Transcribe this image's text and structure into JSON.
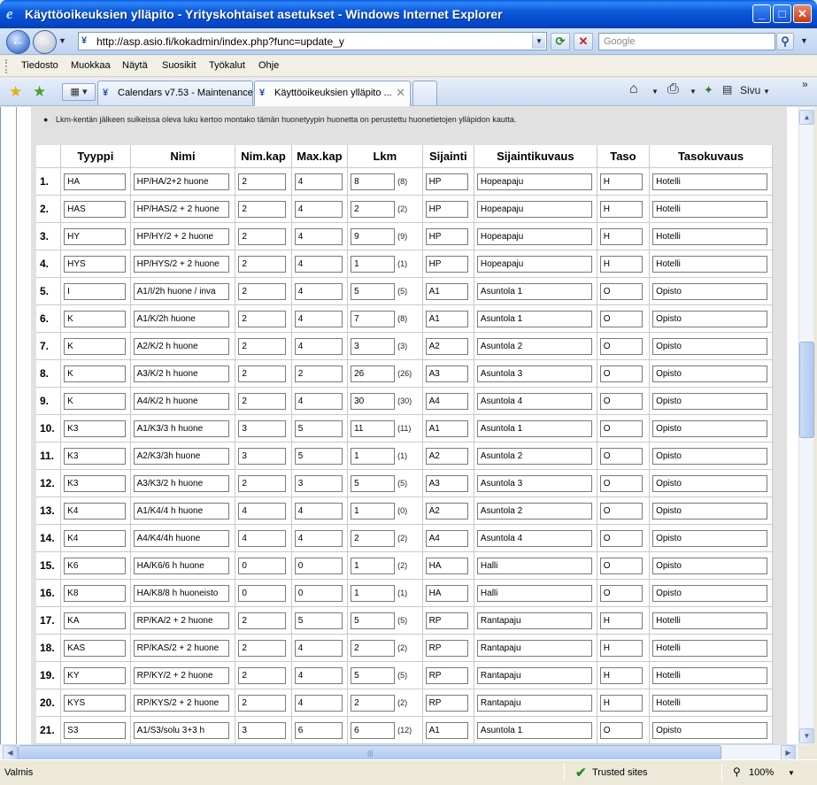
{
  "window": {
    "title": "Käyttöoikeuksien ylläpito - Yrityskohtaiset asetukset - Windows Internet Explorer",
    "buttons": {
      "minimize": "_",
      "maximize": "□",
      "close": "✕"
    }
  },
  "address": {
    "url": "http://asp.asio.fi/kokadmin/index.php?func=update_y",
    "search_placeholder": "Google"
  },
  "menu": [
    "Tiedosto",
    "Muokkaa",
    "Näytä",
    "Suosikit",
    "Työkalut",
    "Ohje"
  ],
  "tabs": [
    {
      "label": "Calendars v7.53 - Maintenance",
      "active": false
    },
    {
      "label": "Käyttöoikeuksien ylläpito ...",
      "active": true
    }
  ],
  "commands": {
    "home": "⌂",
    "print": "⎙",
    "page": "Sivu"
  },
  "note": "Lkm-kentän jälkeen sulkeissa oleva luku kertoo montako tämän huonetyypin huonetta on perustettu huonetietojen ylläpidon kautta.",
  "table": {
    "headers": [
      "",
      "Tyyppi",
      "Nimi",
      "Nim.kap",
      "Max.kap",
      "Lkm",
      "Sijainti",
      "Sijaintikuvaus",
      "Taso",
      "Tasokuvaus"
    ],
    "rows": [
      {
        "n": "1.",
        "tyyppi": "HA",
        "nimi": "HP/HA/2+2 huone",
        "nimkap": "2",
        "maxkap": "4",
        "lkm": "8",
        "paren": "(8)",
        "sijainti": "HP",
        "kuvaus": "Hopeapaju",
        "taso": "H",
        "tasokuvaus": "Hotelli"
      },
      {
        "n": "2.",
        "tyyppi": "HAS",
        "nimi": "HP/HAS/2 + 2 huone",
        "nimkap": "2",
        "maxkap": "4",
        "lkm": "2",
        "paren": "(2)",
        "sijainti": "HP",
        "kuvaus": "Hopeapaju",
        "taso": "H",
        "tasokuvaus": "Hotelli"
      },
      {
        "n": "3.",
        "tyyppi": "HY",
        "nimi": "HP/HY/2 + 2 huone",
        "nimkap": "2",
        "maxkap": "4",
        "lkm": "9",
        "paren": "(9)",
        "sijainti": "HP",
        "kuvaus": "Hopeapaju",
        "taso": "H",
        "tasokuvaus": "Hotelli"
      },
      {
        "n": "4.",
        "tyyppi": "HYS",
        "nimi": "HP/HYS/2 + 2 huone",
        "nimkap": "2",
        "maxkap": "4",
        "lkm": "1",
        "paren": "(1)",
        "sijainti": "HP",
        "kuvaus": "Hopeapaju",
        "taso": "H",
        "tasokuvaus": "Hotelli"
      },
      {
        "n": "5.",
        "tyyppi": "I",
        "nimi": "A1/I/2h huone / inva",
        "nimkap": "2",
        "maxkap": "4",
        "lkm": "5",
        "paren": "(5)",
        "sijainti": "A1",
        "kuvaus": "Asuntola 1",
        "taso": "O",
        "tasokuvaus": "Opisto"
      },
      {
        "n": "6.",
        "tyyppi": "K",
        "nimi": "A1/K/2h huone",
        "nimkap": "2",
        "maxkap": "4",
        "lkm": "7",
        "paren": "(8)",
        "sijainti": "A1",
        "kuvaus": "Asuntola 1",
        "taso": "O",
        "tasokuvaus": "Opisto"
      },
      {
        "n": "7.",
        "tyyppi": "K",
        "nimi": "A2/K/2 h huone",
        "nimkap": "2",
        "maxkap": "4",
        "lkm": "3",
        "paren": "(3)",
        "sijainti": "A2",
        "kuvaus": "Asuntola 2",
        "taso": "O",
        "tasokuvaus": "Opisto"
      },
      {
        "n": "8.",
        "tyyppi": "K",
        "nimi": "A3/K/2 h huone",
        "nimkap": "2",
        "maxkap": "2",
        "lkm": "26",
        "paren": "(26)",
        "sijainti": "A3",
        "kuvaus": "Asuntola 3",
        "taso": "O",
        "tasokuvaus": "Opisto"
      },
      {
        "n": "9.",
        "tyyppi": "K",
        "nimi": "A4/K/2 h huone",
        "nimkap": "2",
        "maxkap": "4",
        "lkm": "30",
        "paren": "(30)",
        "sijainti": "A4",
        "kuvaus": "Asuntola 4",
        "taso": "O",
        "tasokuvaus": "Opisto"
      },
      {
        "n": "10.",
        "tyyppi": "K3",
        "nimi": "A1/K3/3 h huone",
        "nimkap": "3",
        "maxkap": "5",
        "lkm": "11",
        "paren": "(11)",
        "sijainti": "A1",
        "kuvaus": "Asuntola 1",
        "taso": "O",
        "tasokuvaus": "Opisto"
      },
      {
        "n": "11.",
        "tyyppi": "K3",
        "nimi": "A2/K3/3h huone",
        "nimkap": "3",
        "maxkap": "5",
        "lkm": "1",
        "paren": "(1)",
        "sijainti": "A2",
        "kuvaus": "Asuntola 2",
        "taso": "O",
        "tasokuvaus": "Opisto"
      },
      {
        "n": "12.",
        "tyyppi": "K3",
        "nimi": "A3/K3/2 h huone",
        "nimkap": "2",
        "maxkap": "3",
        "lkm": "5",
        "paren": "(5)",
        "sijainti": "A3",
        "kuvaus": "Asuntola 3",
        "taso": "O",
        "tasokuvaus": "Opisto"
      },
      {
        "n": "13.",
        "tyyppi": "K4",
        "nimi": "A1/K4/4 h huone",
        "nimkap": "4",
        "maxkap": "4",
        "lkm": "1",
        "paren": "(0)",
        "sijainti": "A2",
        "kuvaus": "Asuntola 2",
        "taso": "O",
        "tasokuvaus": "Opisto"
      },
      {
        "n": "14.",
        "tyyppi": "K4",
        "nimi": "A4/K4/4h huone",
        "nimkap": "4",
        "maxkap": "4",
        "lkm": "2",
        "paren": "(2)",
        "sijainti": "A4",
        "kuvaus": "Asuntola 4",
        "taso": "O",
        "tasokuvaus": "Opisto"
      },
      {
        "n": "15.",
        "tyyppi": "K6",
        "nimi": "HA/K6/6 h huone",
        "nimkap": "0",
        "maxkap": "0",
        "lkm": "1",
        "paren": "(2)",
        "sijainti": "HA",
        "kuvaus": "Halli",
        "taso": "O",
        "tasokuvaus": "Opisto"
      },
      {
        "n": "16.",
        "tyyppi": "K8",
        "nimi": "HA/K8/8 h huoneisto",
        "nimkap": "0",
        "maxkap": "0",
        "lkm": "1",
        "paren": "(1)",
        "sijainti": "HA",
        "kuvaus": "Halli",
        "taso": "O",
        "tasokuvaus": "Opisto"
      },
      {
        "n": "17.",
        "tyyppi": "KA",
        "nimi": "RP/KA/2 + 2 huone",
        "nimkap": "2",
        "maxkap": "5",
        "lkm": "5",
        "paren": "(5)",
        "sijainti": "RP",
        "kuvaus": "Rantapaju",
        "taso": "H",
        "tasokuvaus": "Hotelli"
      },
      {
        "n": "18.",
        "tyyppi": "KAS",
        "nimi": "RP/KAS/2 + 2 huone",
        "nimkap": "2",
        "maxkap": "4",
        "lkm": "2",
        "paren": "(2)",
        "sijainti": "RP",
        "kuvaus": "Rantapaju",
        "taso": "H",
        "tasokuvaus": "Hotelli"
      },
      {
        "n": "19.",
        "tyyppi": "KY",
        "nimi": "RP/KY/2 + 2 huone",
        "nimkap": "2",
        "maxkap": "4",
        "lkm": "5",
        "paren": "(5)",
        "sijainti": "RP",
        "kuvaus": "Rantapaju",
        "taso": "H",
        "tasokuvaus": "Hotelli"
      },
      {
        "n": "20.",
        "tyyppi": "KYS",
        "nimi": "RP/KYS/2 + 2 huone",
        "nimkap": "2",
        "maxkap": "4",
        "lkm": "2",
        "paren": "(2)",
        "sijainti": "RP",
        "kuvaus": "Rantapaju",
        "taso": "H",
        "tasokuvaus": "Hotelli"
      },
      {
        "n": "21.",
        "tyyppi": "S3",
        "nimi": "A1/S3/solu 3+3 h",
        "nimkap": "3",
        "maxkap": "6",
        "lkm": "6",
        "paren": "(12)",
        "sijainti": "A1",
        "kuvaus": "Asuntola 1",
        "taso": "O",
        "tasokuvaus": "Opisto"
      }
    ]
  },
  "status": {
    "text": "Valmis",
    "zone": "Trusted sites",
    "zoom": "100%"
  }
}
